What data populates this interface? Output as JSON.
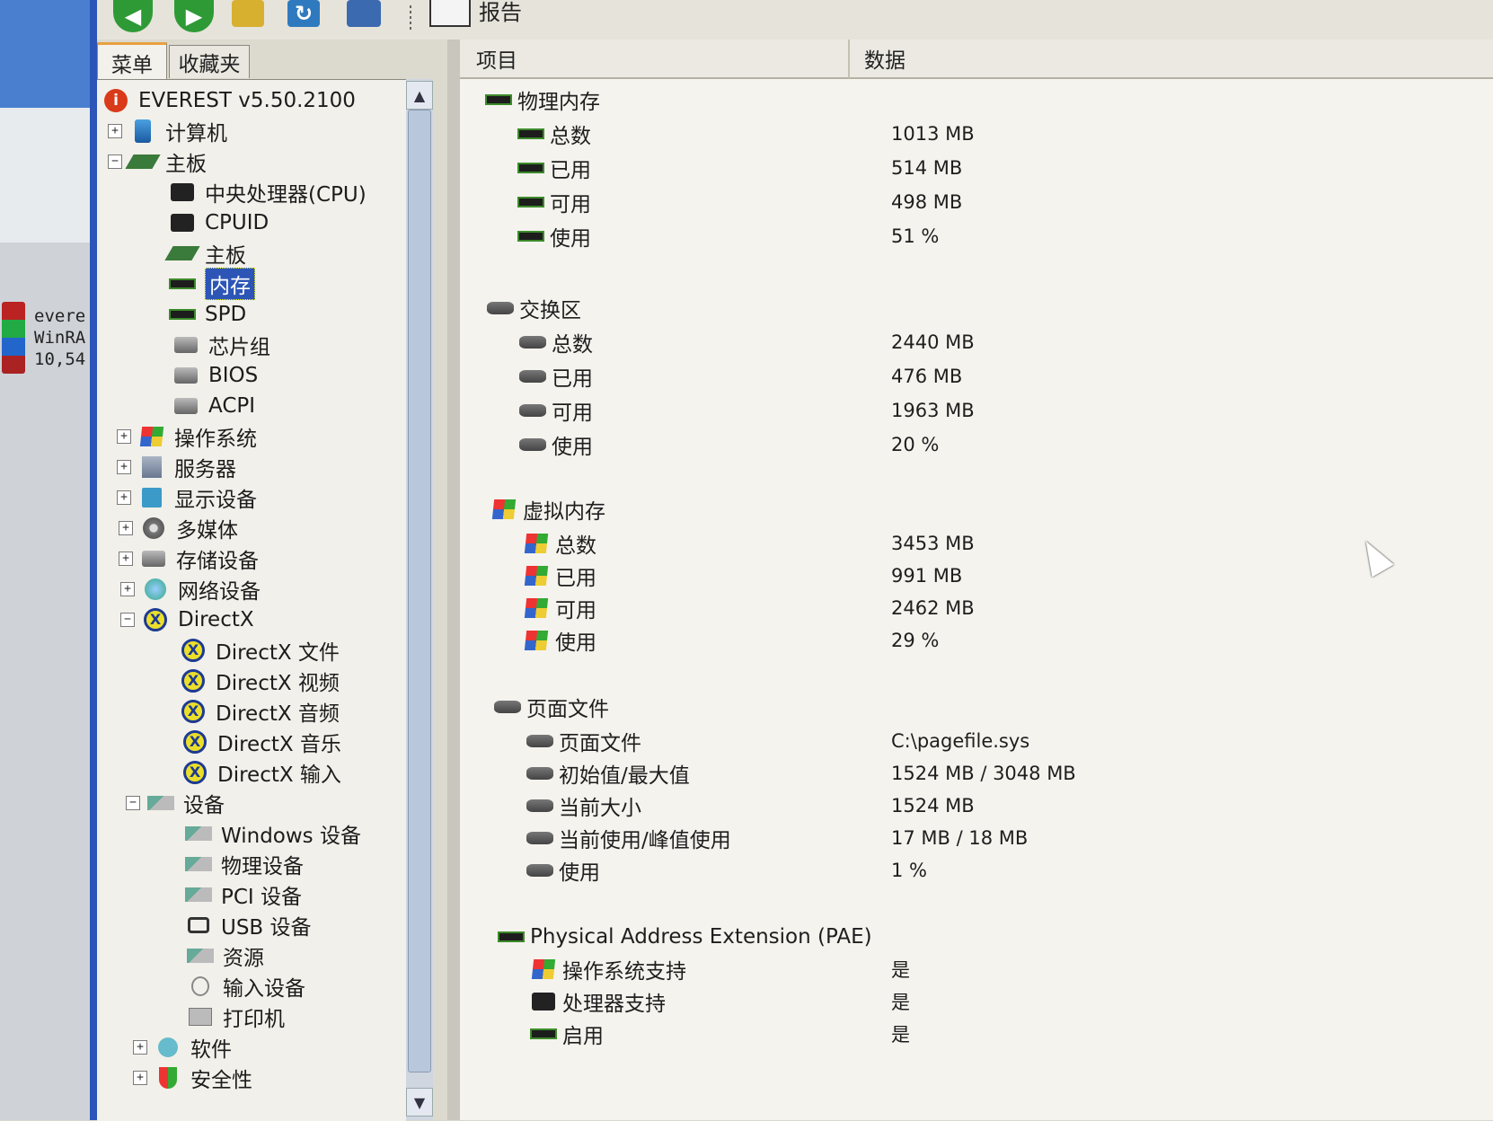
{
  "desktop": {
    "icon_label": "evere\nWinRA\n10,54"
  },
  "toolbar": {
    "report_label": "报告"
  },
  "tabs": {
    "menu": "菜单",
    "favorites": "收藏夹"
  },
  "tree": {
    "root": "EVEREST v5.50.2100",
    "computer": "计算机",
    "motherboard_group": "主板",
    "cpu": "中央处理器(CPU)",
    "cpuid": "CPUID",
    "motherboard": "主板",
    "memory": "内存",
    "spd": "SPD",
    "chipset": "芯片组",
    "bios": "BIOS",
    "acpi": "ACPI",
    "os": "操作系统",
    "server": "服务器",
    "display": "显示设备",
    "multimedia": "多媒体",
    "storage": "存储设备",
    "network": "网络设备",
    "directx": "DirectX",
    "dx_files": "DirectX 文件",
    "dx_video": "DirectX 视频",
    "dx_audio": "DirectX 音频",
    "dx_music": "DirectX 音乐",
    "dx_input": "DirectX 输入",
    "devices": "设备",
    "windows_devices": "Windows 设备",
    "physical_devices": "物理设备",
    "pci_devices": "PCI 设备",
    "usb_devices": "USB 设备",
    "resources": "资源",
    "input_devices": "输入设备",
    "printers": "打印机",
    "software": "软件",
    "security": "安全性"
  },
  "columns": {
    "item": "项目",
    "data": "数据"
  },
  "physical_memory": {
    "title": "物理内存",
    "rows": [
      {
        "label": "总数",
        "value": "1013 MB"
      },
      {
        "label": "已用",
        "value": "514 MB"
      },
      {
        "label": "可用",
        "value": "498 MB"
      },
      {
        "label": "使用",
        "value": "51 %"
      }
    ]
  },
  "swap": {
    "title": "交换区",
    "rows": [
      {
        "label": "总数",
        "value": "2440 MB"
      },
      {
        "label": "已用",
        "value": "476 MB"
      },
      {
        "label": "可用",
        "value": "1963 MB"
      },
      {
        "label": "使用",
        "value": "20 %"
      }
    ]
  },
  "virtual_memory": {
    "title": "虚拟内存",
    "rows": [
      {
        "label": "总数",
        "value": "3453 MB"
      },
      {
        "label": "已用",
        "value": "991 MB"
      },
      {
        "label": "可用",
        "value": "2462 MB"
      },
      {
        "label": "使用",
        "value": "29 %"
      }
    ]
  },
  "page_file": {
    "title": "页面文件",
    "rows": [
      {
        "label": "页面文件",
        "value": "C:\\pagefile.sys"
      },
      {
        "label": "初始值/最大值",
        "value": "1524 MB / 3048 MB"
      },
      {
        "label": "当前大小",
        "value": "1524 MB"
      },
      {
        "label": "当前使用/峰值使用",
        "value": "17 MB / 18 MB"
      },
      {
        "label": "使用",
        "value": "1 %"
      }
    ]
  },
  "pae": {
    "title": "Physical Address Extension (PAE)",
    "rows": [
      {
        "label": "操作系统支持",
        "value": "是"
      },
      {
        "label": "处理器支持",
        "value": "是"
      },
      {
        "label": "启用",
        "value": "是"
      }
    ]
  },
  "colors": {
    "selection": "#2c55b6",
    "window_border": "#2b55b8"
  }
}
